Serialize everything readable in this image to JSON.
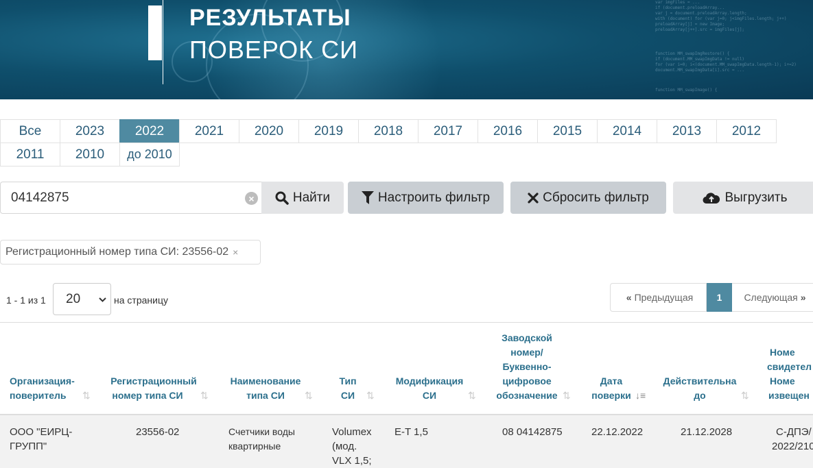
{
  "banner": {
    "title_line1": "РЕЗУЛЬТАТЫ",
    "title_line2": "ПОВЕРОК СИ"
  },
  "year_tabs": {
    "row1": [
      "Все",
      "2023",
      "2022",
      "2021",
      "2020",
      "2019",
      "2018",
      "2017",
      "2016",
      "2015",
      "2014",
      "2013",
      "2012"
    ],
    "row2": [
      "2011",
      "2010",
      "до 2010"
    ],
    "active": "2022"
  },
  "search": {
    "value": "04142875",
    "clear_icon": "×"
  },
  "buttons": {
    "find": "Найти",
    "filter": "Настроить фильтр",
    "reset": "Сбросить фильтр",
    "export": "Выгрузить"
  },
  "active_filter": {
    "label": "Регистрационный номер типа СИ: 23556-02",
    "remove": "×"
  },
  "pagination": {
    "count": "1 - 1 из 1",
    "per_page": "20",
    "per_page_label": "на страницу",
    "prev": "Предыдущая",
    "current": "1",
    "next": "Следующая"
  },
  "table": {
    "headers": [
      [
        "Организация-",
        "поверитель"
      ],
      [
        "Регистрационный",
        "номер типа СИ"
      ],
      [
        "Наименование",
        "типа СИ"
      ],
      [
        "Тип",
        "СИ"
      ],
      [
        "Модификация",
        "СИ"
      ],
      [
        "Заводской",
        "номер/",
        "Буквенно-",
        "цифровое",
        "обозначение"
      ],
      [
        "Дата",
        "поверки"
      ],
      [
        "Действительна",
        "до"
      ],
      [
        "Номе",
        "свидетел",
        "Номе",
        "извещен"
      ]
    ],
    "rows": [
      {
        "org": [
          "ООО \"ЕИРЦ-",
          "ГРУПП\""
        ],
        "reg": "23556-02",
        "name": [
          "Счетчики воды",
          "квартирные"
        ],
        "type": [
          "Volumex",
          "(мод.",
          "VLX 1,5;"
        ],
        "mod": "E-T 1,5",
        "serial": "08 04142875",
        "date": "22.12.2022",
        "valid": "21.12.2028",
        "cert": [
          "С-ДПЭ/",
          "2022/210"
        ]
      }
    ]
  }
}
